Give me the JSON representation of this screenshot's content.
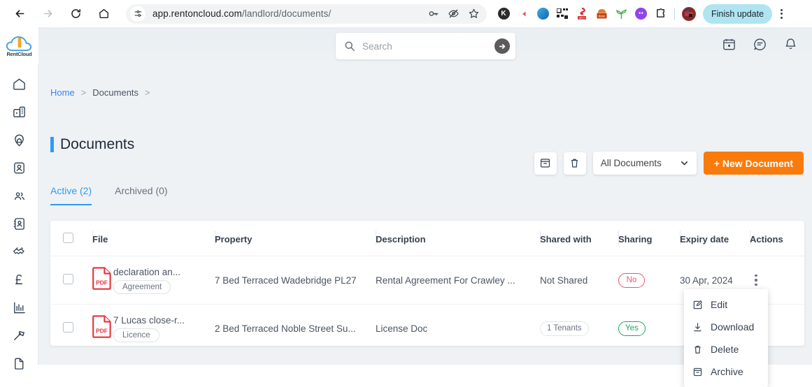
{
  "browser": {
    "back_icon": "back-arrow-icon",
    "forward_icon": "forward-arrow-icon",
    "reload_icon": "reload-icon",
    "home_icon": "home-icon",
    "site_settings_icon": "site-settings-icon",
    "url_host": "app.rentoncloud.com",
    "url_path": "/landlord/documents/",
    "url_full": "app.rentoncloud.com/landlord/documents/",
    "password_icon": "key-icon",
    "tracking_icon": "eye-off-icon",
    "bookmark_icon": "star-icon",
    "extensions": [
      {
        "name": "kick-extension-icon",
        "label": "K",
        "color": "#2b2b2b"
      },
      {
        "name": "play-extension-icon",
        "label": "",
        "color": "#ef5350"
      },
      {
        "name": "torrent-extension-icon",
        "label": "",
        "color": "#1e88c9"
      },
      {
        "name": "qr-extension-icon",
        "label": "",
        "color": "#222222"
      },
      {
        "name": "seo-extension-icon",
        "label": "SEO",
        "color": "#d32f2f"
      },
      {
        "name": "desc-extension-icon",
        "label": "desc",
        "color": "#c1440e"
      },
      {
        "name": "grammar-extension-icon",
        "label": "",
        "color": "#4caf50"
      },
      {
        "name": "ghost-extension-icon",
        "label": "",
        "color": "#8e44ef"
      },
      {
        "name": "puzzle-extension-icon",
        "label": "",
        "color": "#1f1f1f"
      }
    ],
    "profile_icon": "profile-avatar",
    "finish_update_label": "Finish update",
    "menu_icon": "browser-menu-icon"
  },
  "sidebar": {
    "logo_text": "RentCloud",
    "items": [
      {
        "icon": "home-icon",
        "name": "sidebar-item-dashboard"
      },
      {
        "icon": "building-icon",
        "name": "sidebar-item-properties"
      },
      {
        "icon": "location-pin-icon",
        "name": "sidebar-item-locations"
      },
      {
        "icon": "tenant-card-icon",
        "name": "sidebar-item-tenants"
      },
      {
        "icon": "people-icon",
        "name": "sidebar-item-contacts"
      },
      {
        "icon": "address-book-icon",
        "name": "sidebar-item-directory"
      },
      {
        "icon": "handshake-icon",
        "name": "sidebar-item-agreements"
      },
      {
        "icon": "pound-icon",
        "name": "sidebar-item-finances"
      },
      {
        "icon": "chart-icon",
        "name": "sidebar-item-reports"
      },
      {
        "icon": "hammer-icon",
        "name": "sidebar-item-maintenance"
      },
      {
        "icon": "document-icon",
        "name": "sidebar-item-documents"
      }
    ]
  },
  "topbar": {
    "search_placeholder": "Search",
    "search_value": "",
    "search_icon": "search-icon",
    "go_icon": "arrow-right-circle-icon",
    "calendar_icon": "calendar-icon",
    "messages_icon": "message-icon",
    "notifications_icon": "bell-icon"
  },
  "breadcrumb": {
    "home": "Home",
    "sep1": ">",
    "documents": "Documents",
    "sep2": ">"
  },
  "page": {
    "title": "Documents"
  },
  "toolbar": {
    "archive_icon": "archive-box-icon",
    "delete_icon": "trash-icon",
    "filter_value": "All Documents",
    "filter_options": [
      "All Documents"
    ],
    "chevron_icon": "chevron-down-icon",
    "new_document_label": "+  New Document"
  },
  "tabs": [
    {
      "label": "Active (2)",
      "active": true,
      "name": "tab-active"
    },
    {
      "label": "Archived (0)",
      "active": false,
      "name": "tab-archived"
    }
  ],
  "table": {
    "headers": {
      "checkbox": "",
      "file": "File",
      "property": "Property",
      "description": "Description",
      "shared_with": "Shared with",
      "sharing": "Sharing",
      "expiry": "Expiry date",
      "actions": "Actions"
    },
    "rows": [
      {
        "file_name": "declaration an...",
        "file_type": "PDF",
        "tag": "Agreement",
        "property": "7 Bed Terraced Wadebridge PL27",
        "description": "Rental Agreement For Crawley ...",
        "shared_with": "Not Shared",
        "shared_with_style": "plain",
        "sharing": "No",
        "sharing_state": "no",
        "expiry": "30 Apr, 2024"
      },
      {
        "file_name": "7 Lucas close-r...",
        "file_type": "PDF",
        "tag": "Licence",
        "property": "2 Bed Terraced Noble Street Su...",
        "description": "License Doc",
        "shared_with": "1 Tenants",
        "shared_with_style": "pill",
        "sharing": "Yes",
        "sharing_state": "yes",
        "expiry": ""
      }
    ]
  },
  "context_menu": {
    "items": [
      {
        "label": "Edit",
        "icon": "edit-pencil-icon",
        "name": "menu-item-edit"
      },
      {
        "label": "Download",
        "icon": "download-icon",
        "name": "menu-item-download"
      },
      {
        "label": "Delete",
        "icon": "trash-icon",
        "name": "menu-item-delete"
      },
      {
        "label": "Archive",
        "icon": "archive-box-icon",
        "name": "menu-item-archive"
      }
    ]
  },
  "colors": {
    "accent_blue": "#2f9bf5",
    "primary_orange": "#f97b0c",
    "pdf_red": "#e8313c",
    "yes_green": "#1aa85f",
    "no_red": "#e8566f",
    "page_bg": "#eef2f5"
  }
}
